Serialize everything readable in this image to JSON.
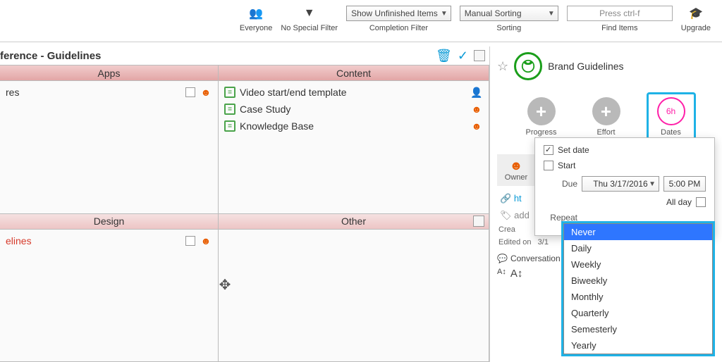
{
  "toolbar": {
    "scope": "Everyone",
    "filter": "No Special Filter",
    "completion_value": "Show Unfinished Items",
    "completion_label": "Completion Filter",
    "sorting_value": "Manual Sorting",
    "sorting_label": "Sorting",
    "search_placeholder": "Press ctrl-f",
    "search_label": "Find Items",
    "upgrade": "Upgrade"
  },
  "header": {
    "title": "ference - Guidelines"
  },
  "columns": {
    "a": "Apps",
    "b": "Content",
    "c": "Design",
    "d": "Other"
  },
  "apps": {
    "row1": "res"
  },
  "content": {
    "row1": "Video start/end template",
    "row2": "Case Study",
    "row3": "Knowledge Base"
  },
  "design": {
    "row1": "elines"
  },
  "detail": {
    "title": "Brand Guidelines",
    "progress": "Progress",
    "effort": "Effort",
    "dates": "Dates",
    "dates_badge": "6h",
    "owner": "Owner",
    "url_prefix": "ht",
    "tag": "add",
    "created_label": "Crea",
    "edited_label": "Edited on",
    "edited_date_frag": "3/1",
    "conversation": "Conversation"
  },
  "datepanel": {
    "setdate": "Set date",
    "start": "Start",
    "due": "Due",
    "due_date": "Thu 3/17/2016",
    "due_time": "5:00 PM",
    "allday": "All day",
    "repeat": "Repeat"
  },
  "repeat_options": [
    "Never",
    "Daily",
    "Weekly",
    "Biweekly",
    "Monthly",
    "Quarterly",
    "Semesterly",
    "Yearly"
  ]
}
